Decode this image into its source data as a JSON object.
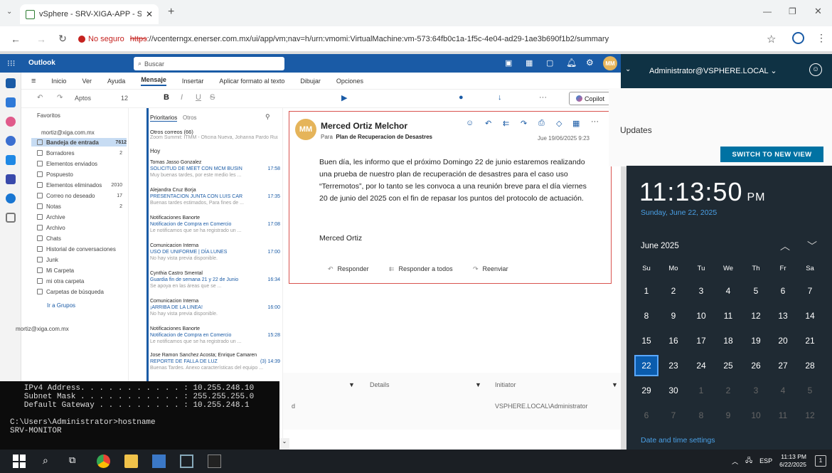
{
  "browser": {
    "tab_title": "vSphere - SRV-XIGA-APP - Su",
    "security_label": "No seguro",
    "url_scheme": "https",
    "url_rest": "://vcenterngx.enerser.com.mx/ui/app/vm;nav=h/urn:vmomi:VirtualMachine:vm-573:64fb0c1a-1f5c-4e04-ad29-1ae3b690f1b2/summary"
  },
  "outlook": {
    "app_name": "Outlook",
    "search_placeholder": "Buscar",
    "avatar_initials": "MM",
    "menu": [
      "Inicio",
      "Ver",
      "Ayuda",
      "Mensaje",
      "Insertar",
      "Aplicar formato al texto",
      "Dibujar",
      "Opciones"
    ],
    "ribbon_font": "Aptos",
    "ribbon_size": "12",
    "copilot_label": "Copilot",
    "folders_header": "Favoritos",
    "account": "mortiz@xiga.com.mx",
    "folders": [
      {
        "label": "Bandeja de entrada",
        "count": "7612"
      },
      {
        "label": "Borradores",
        "count": "2"
      },
      {
        "label": "Elementos enviados",
        "count": ""
      },
      {
        "label": "Pospuesto",
        "count": ""
      },
      {
        "label": "Elementos eliminados",
        "count": "2010"
      },
      {
        "label": "Correo no deseado",
        "count": "17"
      },
      {
        "label": "Notas",
        "count": "2"
      },
      {
        "label": "Archive",
        "count": ""
      },
      {
        "label": "Archivo",
        "count": ""
      },
      {
        "label": "Chats",
        "count": ""
      },
      {
        "label": "Historial de conversaciones",
        "count": ""
      },
      {
        "label": "Junk",
        "count": ""
      },
      {
        "label": "Mi Carpeta",
        "count": ""
      },
      {
        "label": "mi otra carpeta",
        "count": ""
      },
      {
        "label": "Carpetas de búsqueda",
        "count": ""
      }
    ],
    "go_groups": "Ir a Grupos",
    "account_footer": "mortiz@xiga.com.mx",
    "list_tabs": [
      "Prioritarios",
      "Otros"
    ],
    "other_mail": "Otros correos (66)",
    "other_mail_preview": "Zoom Summit: ITMM - Oficina Nueva, Johanna Pardo Ruiz",
    "section_today": "Hoy",
    "mails": [
      {
        "from": "Tomas Jasso Gonzalez",
        "subject": "SOLICITUD DE MEET CON MCM BUSIN",
        "time": "17:58",
        "preview": "Muy buenas tardes, por este medio les ..."
      },
      {
        "from": "Alejandra Cruz Borja",
        "subject": "PRESENTACION JUNTA CON LUIS CAR",
        "time": "17:35",
        "preview": "Buenas tardes estimados, Para fines de ..."
      },
      {
        "from": "Notificaciones Banorte",
        "subject": "Notificacion de Compra en Comercio",
        "time": "17:08",
        "preview": "Le notificamos que se ha registrado un ..."
      },
      {
        "from": "Comunicacion Interna",
        "subject": "USO DE UNIFORME | DÍA LUNES",
        "time": "17:00",
        "preview": "No hay vista previa disponible."
      },
      {
        "from": "Cynthia Castro Smental",
        "subject": "Guardia fin de semana 21 y 22 de Junio",
        "time": "16:34",
        "preview": "Se apoya en las áreas que se ..."
      },
      {
        "from": "Comunicacion Interna",
        "subject": "¡ARRIBA DE LA LINEA!",
        "time": "16:00",
        "preview": "No hay vista previa disponible."
      },
      {
        "from": "Notificaciones Banorte",
        "subject": "Notificacion de Compra en Comercio",
        "time": "15:28",
        "preview": "Le notificamos que se ha registrado un ..."
      },
      {
        "from": "Jose Ramon Sanchez Acosta; Enrique Camaren",
        "subject": "REPORTE DE FALLA DE LUZ",
        "time": "(3)  14:39",
        "preview": "Buenas Tardes. Anexo características del equipo ..."
      }
    ],
    "reading": {
      "avatar": "MM",
      "sender": "Merced Ortiz Melchor",
      "to_label": "Para",
      "to": "Plan de Recuperacion de Desastres",
      "date": "Jue 19/06/2025 9:23",
      "body": "Buen día, les informo que el próximo Domingo 22 de junio estaremos realizando una prueba de nuestro plan de recuperación de desastres para el caso uso “Terremotos”, por lo tanto  se les convoca a una reunión breve para el día viernes 20 de junio del 2025 con el fin de repasar los puntos del protocolo de actuación.",
      "signature": "Merced Ortiz",
      "actions": [
        "Responder",
        "Responder a todos",
        "Reenviar"
      ]
    }
  },
  "vsphere": {
    "user": "Administrator@VSPHERE.LOCAL",
    "updates": "Updates",
    "switch_button": "SWITCH TO NEW VIEW",
    "table_headers": [
      "Details",
      "Initiator"
    ],
    "row_initiator": "VSPHERE.LOCAL\\Administrator",
    "row_fragment": "d"
  },
  "clock": {
    "time": "11:13:50",
    "ampm": "PM",
    "date": "Sunday, June 22, 2025",
    "month": "June 2025",
    "dow": [
      "Su",
      "Mo",
      "Tu",
      "We",
      "Th",
      "Fr",
      "Sa"
    ],
    "weeks": [
      [
        "1",
        "2",
        "3",
        "4",
        "5",
        "6",
        "7"
      ],
      [
        "8",
        "9",
        "10",
        "11",
        "12",
        "13",
        "14"
      ],
      [
        "15",
        "16",
        "17",
        "18",
        "19",
        "20",
        "21"
      ],
      [
        "22",
        "23",
        "24",
        "25",
        "26",
        "27",
        "28"
      ],
      [
        "29",
        "30",
        "1",
        "2",
        "3",
        "4",
        "5"
      ],
      [
        "6",
        "7",
        "8",
        "9",
        "10",
        "11",
        "12"
      ]
    ],
    "today": "22",
    "settings_link": "Date and time settings"
  },
  "cmd": {
    "lines": [
      "   IPv4 Address. . . . . . . . . . . : 10.255.248.10",
      "   Subnet Mask . . . . . . . . . . . : 255.255.255.0",
      "   Default Gateway . . . . . . . . . : 10.255.248.1",
      "",
      "C:\\Users\\Administrator>hostname",
      "SRV-MONITOR"
    ]
  },
  "taskbar": {
    "lang": "ESP",
    "time": "11:13 PM",
    "date": "6/22/2025",
    "notification_count": "1"
  },
  "colors": {
    "outlook_blue": "#1a5ba6",
    "vsphere_dark": "#0f3244",
    "switch_blue": "#0072a3",
    "flyout_bg": "#1f2a33",
    "highlight_red": "#d9534f"
  }
}
